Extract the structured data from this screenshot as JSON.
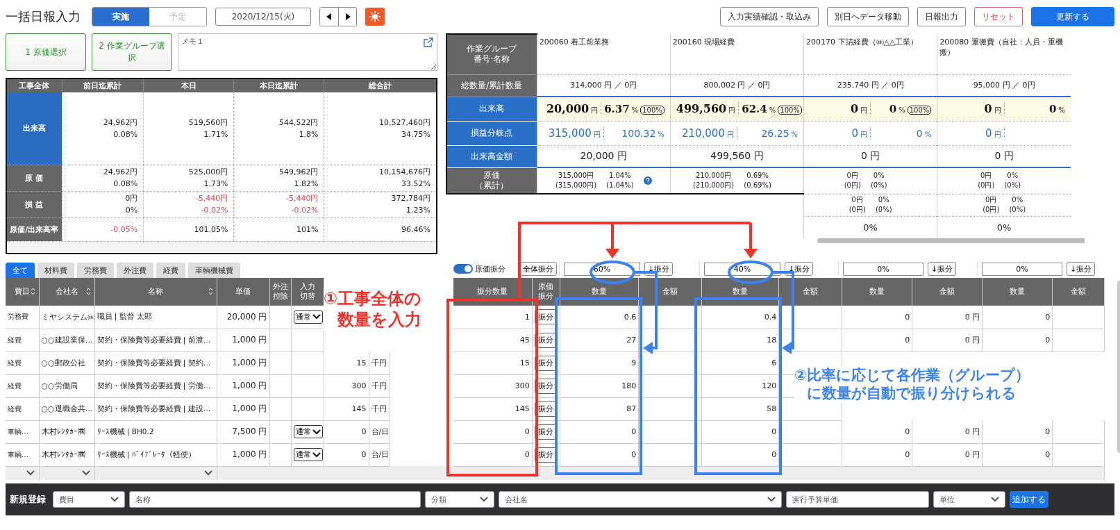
{
  "title": "一括日報入力",
  "mode_tabs": [
    {
      "label": "実施",
      "selected": true
    },
    {
      "label": "予定",
      "selected": false
    }
  ],
  "date": "2020/12/15(火)",
  "actions": [
    {
      "label": "入力実績確認・取込み",
      "kind": "default"
    },
    {
      "label": "別日へデータ移動",
      "kind": "default"
    },
    {
      "label": "日報出力",
      "kind": "default"
    },
    {
      "label": "リセット",
      "kind": "danger"
    },
    {
      "label": "更新する",
      "kind": "primary"
    }
  ],
  "steps": [
    "1 原価選択",
    "2 作業グループ選択"
  ],
  "memo": {
    "placeholder": "メモ１"
  },
  "summary": {
    "corner": "工事全体",
    "columns": [
      "前日迄累計",
      "本日",
      "本日迄累計",
      "総合計"
    ],
    "rows": [
      {
        "label": "出来高",
        "kind": "highlight",
        "cells": [
          {
            "lines": [
              "24,962円",
              "0.08%"
            ],
            "negative": false
          },
          {
            "lines": [
              "519,560円",
              "1.71%"
            ],
            "negative": false
          },
          {
            "lines": [
              "544,522円",
              "1.8%"
            ],
            "negative": false
          },
          {
            "lines": [
              "10,527,460円",
              "34.75%"
            ],
            "negative": false
          }
        ]
      },
      {
        "label": "原 価",
        "kind": "normal",
        "cells": [
          {
            "lines": [
              "24,962円",
              "0.08%"
            ],
            "negative": false
          },
          {
            "lines": [
              "525,000円",
              "1.73%"
            ],
            "negative": false
          },
          {
            "lines": [
              "549,962円",
              "1.82%"
            ],
            "negative": false
          },
          {
            "lines": [
              "10,154,676円",
              "33.52%"
            ],
            "negative": false
          }
        ]
      },
      {
        "label": "損 益",
        "kind": "normal",
        "cells": [
          {
            "lines": [
              "0円",
              "0%"
            ],
            "negative": false
          },
          {
            "lines": [
              "-5,440円",
              "-0.02%"
            ],
            "negative": true
          },
          {
            "lines": [
              "-5,440円",
              "-0.02%"
            ],
            "negative": true
          },
          {
            "lines": [
              "372,784円",
              "1.23%"
            ],
            "negative": false
          }
        ]
      },
      {
        "label": "原価/出来高率",
        "kind": "normal",
        "cells": [
          {
            "lines": [
              "-0.05%"
            ],
            "negative": true
          },
          {
            "lines": [
              "101.05%"
            ],
            "negative": false
          },
          {
            "lines": [
              "101%"
            ],
            "negative": false
          },
          {
            "lines": [
              "96.46%"
            ],
            "negative": false
          }
        ]
      }
    ]
  },
  "groups_panel": {
    "row_labels": [
      {
        "lines": [
          "作業グループ",
          "番号·名称"
        ],
        "kind": "normal"
      },
      {
        "lines": [
          "総数量/累計数量"
        ],
        "kind": "normal"
      },
      {
        "lines": [
          "出来高"
        ],
        "kind": "highlight"
      },
      {
        "lines": [
          "損益分岐点"
        ],
        "kind": "highlight"
      },
      {
        "lines": [
          "出来高金額"
        ],
        "kind": "highlight"
      },
      {
        "lines": [
          "原価",
          "（累計）"
        ],
        "kind": "normal"
      }
    ],
    "groups": [
      {
        "name": "200060 着工前業務",
        "total": "314,000 円 ／ 0円",
        "progress": {
          "amount": "20,000",
          "unit": "円",
          "percent": "6.37",
          "percent_unit": "%",
          "badge": "100%"
        },
        "break_even": {
          "amount": "315,000",
          "unit": "円",
          "percent": "100.32",
          "percent_unit": "%"
        },
        "progress_amount": "20,000 円",
        "cost": [
          "315,000円",
          "1.04%",
          "(315,000円)",
          "(1.04%)"
        ],
        "has_help": true
      },
      {
        "name": "200160 現場経費",
        "total": "800,002 円 ／ 0円",
        "progress": {
          "amount": "499,560",
          "unit": "円",
          "percent": "62.4",
          "percent_unit": "%",
          "badge": "100%"
        },
        "break_even": {
          "amount": "210,000",
          "unit": "円",
          "percent": "26.25",
          "percent_unit": "%"
        },
        "progress_amount": "499,560 円",
        "cost": [
          "210,000円",
          "0.69%",
          "(210,000円)",
          "(0.69%)"
        ],
        "has_help": false
      },
      {
        "name": "200170 下請経費（㈱△△工業）",
        "total": "235,740 円 ／ 0円",
        "progress": {
          "amount": "0",
          "unit": "円",
          "percent": "0",
          "percent_unit": "%",
          "badge": "100%"
        },
        "break_even": {
          "amount": "0",
          "unit": "円",
          "percent": "0",
          "percent_unit": "%"
        },
        "progress_amount": "0 円",
        "cost": [
          "0円",
          "0%",
          "(0円)",
          "(0%)"
        ],
        "has_help": false,
        "cost_extra": [
          "0円",
          "0%",
          "(0円)",
          "(0%)"
        ],
        "rate": "0%"
      },
      {
        "name": "200080 運搬費（自社：人員・重機搬）",
        "total": "95,000 円 ／ 0円",
        "progress": {
          "amount": "0",
          "unit": "円",
          "percent": "0",
          "percent_unit": "%"
        },
        "break_even": {
          "amount": "0",
          "unit": "円"
        },
        "progress_amount": "0 円",
        "cost": [
          "0円",
          "0%",
          "(0円)",
          "(0%)"
        ],
        "has_help": false,
        "cost_extra": [
          "0円",
          "0%",
          "(0円)",
          "(0%)"
        ],
        "rate": "0%"
      }
    ]
  },
  "category_tabs": [
    {
      "label": "全て",
      "selected": true
    },
    {
      "label": "材料費",
      "selected": false
    },
    {
      "label": "労務費",
      "selected": false
    },
    {
      "label": "外注費",
      "selected": false
    },
    {
      "label": "経費",
      "selected": false
    },
    {
      "label": "車輌機械費",
      "selected": false
    }
  ],
  "allocation": {
    "toggle": {
      "label": "原価振分",
      "on": true
    },
    "all_button": "全体振分",
    "groups": [
      {
        "ratio": "60%",
        "button": "↓振分"
      },
      {
        "ratio": "40%",
        "button": "↓振分"
      },
      {
        "ratio": "0%",
        "button": "↓振分"
      },
      {
        "ratio": "0%",
        "button": "↓振分"
      }
    ]
  },
  "table": {
    "columns": [
      {
        "lines": [
          "費目"
        ],
        "sortable": true
      },
      {
        "lines": [
          "会社名"
        ],
        "sortable": true
      },
      {
        "lines": [
          "名称"
        ],
        "sortable": true
      },
      {
        "lines": [
          "単価"
        ],
        "sortable": false
      },
      {
        "lines": [
          "外注",
          "控除"
        ],
        "sortable": false
      },
      {
        "lines": [
          "入力",
          "切替"
        ],
        "sortable": false
      }
    ],
    "alloc_columns": [
      [
        "振分数量"
      ],
      [
        "原価",
        "振分"
      ]
    ],
    "group_columns": [
      [
        "数量",
        "金額"
      ],
      [
        "数量",
        "金額"
      ],
      [
        "数量",
        "金額"
      ],
      [
        "数量",
        "金額"
      ]
    ],
    "rows": [
      {
        "category": "労務費",
        "company": "ミヤシステム㈱",
        "name": "職員 | 監督 太郎",
        "unit_price": "20,000 円",
        "mode": "通常",
        "alloc_qty": "1",
        "alloc_button": "振分",
        "groups": [
          {
            "quantity": "0.6"
          },
          {
            "quantity": "0.4"
          },
          {
            "quantity": "0",
            "amount": "0 円"
          },
          {
            "quantity": "0"
          }
        ]
      },
      {
        "category": "経費",
        "company": "○○建設業保…",
        "name": "契約・保険費等必要経費 | 前渡…",
        "unit_price": "1,000 円",
        "alloc_qty": "45",
        "alloc_button": "振分",
        "groups": [
          {
            "quantity": "27"
          },
          {
            "quantity": "18"
          },
          {
            "quantity": "0",
            "amount": "0 円"
          },
          {
            "quantity": "0"
          }
        ]
      },
      {
        "category": "経費",
        "company": "○○郵政公社",
        "name": "契約・保険費等必要経費 | 契約…",
        "unit_price": "1,000 円",
        "quantity": "15",
        "unit": "千円",
        "alloc_qty": "15",
        "alloc_button": "振分",
        "groups": [
          {
            "quantity": "9"
          },
          {
            "quantity": "6"
          }
        ]
      },
      {
        "category": "経費",
        "company": "○○労働局",
        "name": "契約・保険費等必要経費 | 労働…",
        "unit_price": "1,000 円",
        "quantity": "300",
        "unit": "千円",
        "alloc_qty": "300",
        "alloc_button": "振分",
        "groups": [
          {
            "quantity": "180"
          },
          {
            "quantity": "120"
          }
        ]
      },
      {
        "category": "経費",
        "company": "○○退職金共…",
        "name": "契約・保険費等必要経費 | 建設…",
        "unit_price": "1,000 円",
        "quantity": "145",
        "unit": "千円",
        "alloc_qty": "145",
        "alloc_button": "振分",
        "groups": [
          {
            "quantity": "87"
          },
          {
            "quantity": "58"
          }
        ]
      },
      {
        "category": "車輌…",
        "company": "木村ﾚﾝﾀｶｰ㈱",
        "name": "ﾘｰｽ機械 | BH0.2",
        "unit_price": "7,500 円",
        "mode": "通常",
        "quantity": "0",
        "unit": "台/日",
        "alloc_qty": "0",
        "alloc_button": "振分",
        "groups": [
          {
            "quantity": "0"
          },
          {
            "quantity": "0"
          },
          {
            "quantity": "0",
            "amount": "0 円"
          },
          {
            "quantity": "0"
          }
        ]
      },
      {
        "category": "車輌…",
        "company": "木村ﾚﾝﾀｶｰ㈱",
        "name": "ﾘｰｽ機械 | ﾊﾞｲﾌﾞﾚｰﾀ（軽便）",
        "unit_price": "1,000 円",
        "mode": "通常",
        "quantity": "0",
        "unit": "台/日",
        "alloc_qty": "0",
        "alloc_button": "振分",
        "groups": [
          {
            "quantity": "0"
          },
          {
            "quantity": "0"
          },
          {
            "quantity": "0",
            "amount": "0 円"
          },
          {
            "quantity": "0"
          }
        ]
      }
    ]
  },
  "annotations": [
    {
      "lines": [
        "①工事全体の",
        "数量を入力"
      ],
      "kind": "input"
    },
    {
      "lines": [
        "②比率に応じて各作業（グループ）",
        "に数量が自動で振り分けられる"
      ],
      "kind": "result"
    }
  ],
  "new_entry": {
    "label": "新規登録",
    "fields": [
      {
        "kind": "select",
        "placeholder": "費目"
      },
      {
        "kind": "text",
        "placeholder": "名称"
      },
      {
        "kind": "select",
        "placeholder": "分類"
      },
      {
        "kind": "select",
        "placeholder": "会社名"
      },
      {
        "kind": "text",
        "placeholder": "実行予算単価"
      },
      {
        "kind": "select",
        "placeholder": "単位"
      }
    ],
    "button": "追加する"
  }
}
